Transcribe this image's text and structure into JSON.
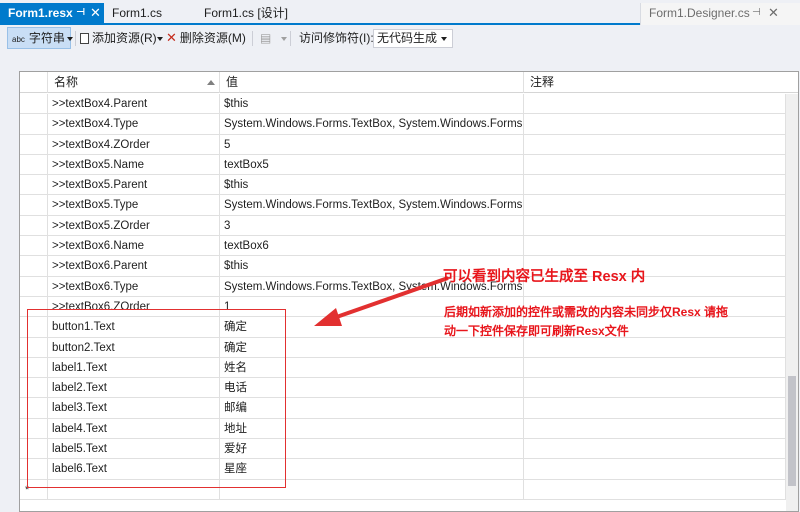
{
  "tabs": [
    {
      "label": "Form1.resx",
      "active": true
    },
    {
      "label": "Form1.cs",
      "active": false
    },
    {
      "label": "Form1.cs [设计]",
      "active": false
    },
    {
      "label": "Form1.Designer.cs",
      "active": false,
      "right": true
    }
  ],
  "toolbar": {
    "strings_icon": "abc",
    "strings_label": "字符串",
    "add_resource": "添加资源(R)",
    "remove_resource": "删除资源(M)",
    "access_label": "访问修饰符(I):",
    "access_value": "无代码生成"
  },
  "grid": {
    "columns": [
      "名称",
      "值",
      "注释"
    ],
    "rows": [
      {
        "name": ">>textBox4.Parent",
        "value": "$this",
        "comment": ""
      },
      {
        "name": ">>textBox4.Type",
        "value": "System.Windows.Forms.TextBox, System.Windows.Forms,",
        "comment": ""
      },
      {
        "name": ">>textBox4.ZOrder",
        "value": "5",
        "comment": ""
      },
      {
        "name": ">>textBox5.Name",
        "value": "textBox5",
        "comment": ""
      },
      {
        "name": ">>textBox5.Parent",
        "value": "$this",
        "comment": ""
      },
      {
        "name": ">>textBox5.Type",
        "value": "System.Windows.Forms.TextBox, System.Windows.Forms,",
        "comment": ""
      },
      {
        "name": ">>textBox5.ZOrder",
        "value": "3",
        "comment": ""
      },
      {
        "name": ">>textBox6.Name",
        "value": "textBox6",
        "comment": ""
      },
      {
        "name": ">>textBox6.Parent",
        "value": "$this",
        "comment": ""
      },
      {
        "name": ">>textBox6.Type",
        "value": "System.Windows.Forms.TextBox, System.Windows.Forms,",
        "comment": ""
      },
      {
        "name": ">>textBox6.ZOrder",
        "value": "1",
        "comment": ""
      },
      {
        "name": "button1.Text",
        "value": "确定",
        "comment": ""
      },
      {
        "name": "button2.Text",
        "value": "确定",
        "comment": ""
      },
      {
        "name": "label1.Text",
        "value": "姓名",
        "comment": ""
      },
      {
        "name": "label2.Text",
        "value": "电话",
        "comment": ""
      },
      {
        "name": "label3.Text",
        "value": "邮编",
        "comment": ""
      },
      {
        "name": "label4.Text",
        "value": "地址",
        "comment": ""
      },
      {
        "name": "label5.Text",
        "value": "爱好",
        "comment": ""
      },
      {
        "name": "label6.Text",
        "value": "星座",
        "comment": ""
      },
      {
        "name": "",
        "value": "",
        "comment": ""
      }
    ],
    "new_row_marker": "*"
  },
  "annotation": {
    "headline": "可以看到内容已生成至 Resx 内",
    "note": "后期如新添加的控件或需改的内容未同步仅Resx 请拖动一下控件保存即可刷新Resx文件",
    "color": "#e8161c"
  }
}
